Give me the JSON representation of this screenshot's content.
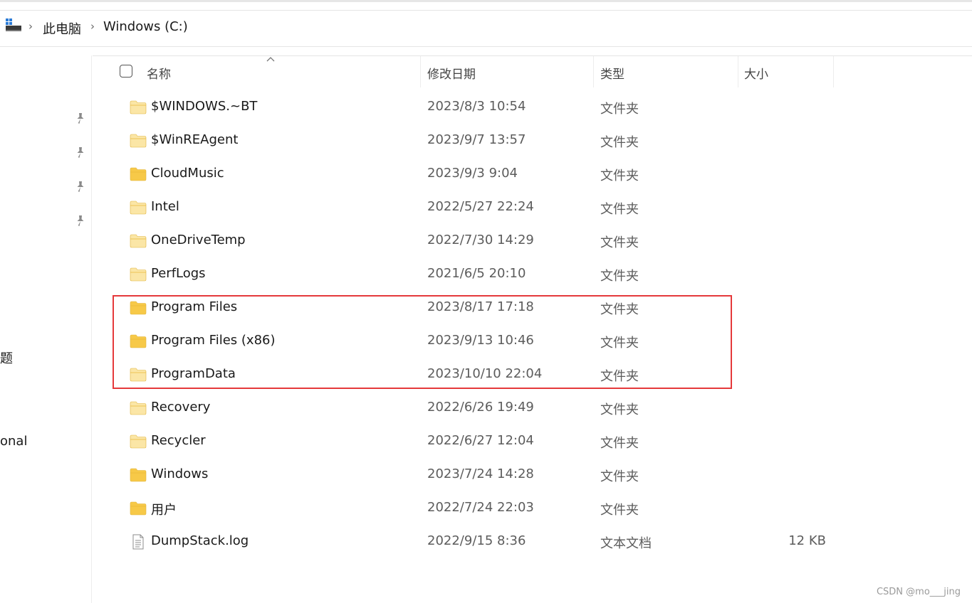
{
  "breadcrumb": {
    "icon": "this-pc-icon",
    "items": [
      "此电脑",
      "Windows (C:)"
    ]
  },
  "nav": {
    "pins": [
      "pin-icon",
      "pin-icon",
      "pin-icon",
      "pin-icon"
    ],
    "fragments": [
      "题",
      "onal"
    ]
  },
  "columns": {
    "name": "名称",
    "date": "修改日期",
    "type": "类型",
    "size": "大小"
  },
  "files": [
    {
      "name": "$WINDOWS.~BT",
      "date": "2023/8/3 10:54",
      "type": "文件夹",
      "size": "",
      "icon": "folder-light-icon"
    },
    {
      "name": "$WinREAgent",
      "date": "2023/9/7 13:57",
      "type": "文件夹",
      "size": "",
      "icon": "folder-light-icon"
    },
    {
      "name": "CloudMusic",
      "date": "2023/9/3 9:04",
      "type": "文件夹",
      "size": "",
      "icon": "folder-icon"
    },
    {
      "name": "Intel",
      "date": "2022/5/27 22:24",
      "type": "文件夹",
      "size": "",
      "icon": "folder-light-icon"
    },
    {
      "name": "OneDriveTemp",
      "date": "2022/7/30 14:29",
      "type": "文件夹",
      "size": "",
      "icon": "folder-light-icon"
    },
    {
      "name": "PerfLogs",
      "date": "2021/6/5 20:10",
      "type": "文件夹",
      "size": "",
      "icon": "folder-light-icon"
    },
    {
      "name": "Program Files",
      "date": "2023/8/17 17:18",
      "type": "文件夹",
      "size": "",
      "icon": "folder-icon"
    },
    {
      "name": "Program Files (x86)",
      "date": "2023/9/13 10:46",
      "type": "文件夹",
      "size": "",
      "icon": "folder-icon"
    },
    {
      "name": "ProgramData",
      "date": "2023/10/10 22:04",
      "type": "文件夹",
      "size": "",
      "icon": "folder-light-icon"
    },
    {
      "name": "Recovery",
      "date": "2022/6/26 19:49",
      "type": "文件夹",
      "size": "",
      "icon": "folder-light-icon"
    },
    {
      "name": "Recycler",
      "date": "2022/6/27 12:04",
      "type": "文件夹",
      "size": "",
      "icon": "folder-light-icon"
    },
    {
      "name": "Windows",
      "date": "2023/7/24 14:28",
      "type": "文件夹",
      "size": "",
      "icon": "folder-icon"
    },
    {
      "name": "用户",
      "date": "2022/7/24 22:03",
      "type": "文件夹",
      "size": "",
      "icon": "folder-icon"
    },
    {
      "name": "DumpStack.log",
      "date": "2022/9/15 8:36",
      "type": "文本文档",
      "size": "12 KB",
      "icon": "text-file-icon"
    }
  ],
  "colors": {
    "highlight": "#e5393b",
    "folder": "#f7c948",
    "folder_light": "#fbe6a6"
  },
  "watermark": "CSDN @mo___jing"
}
